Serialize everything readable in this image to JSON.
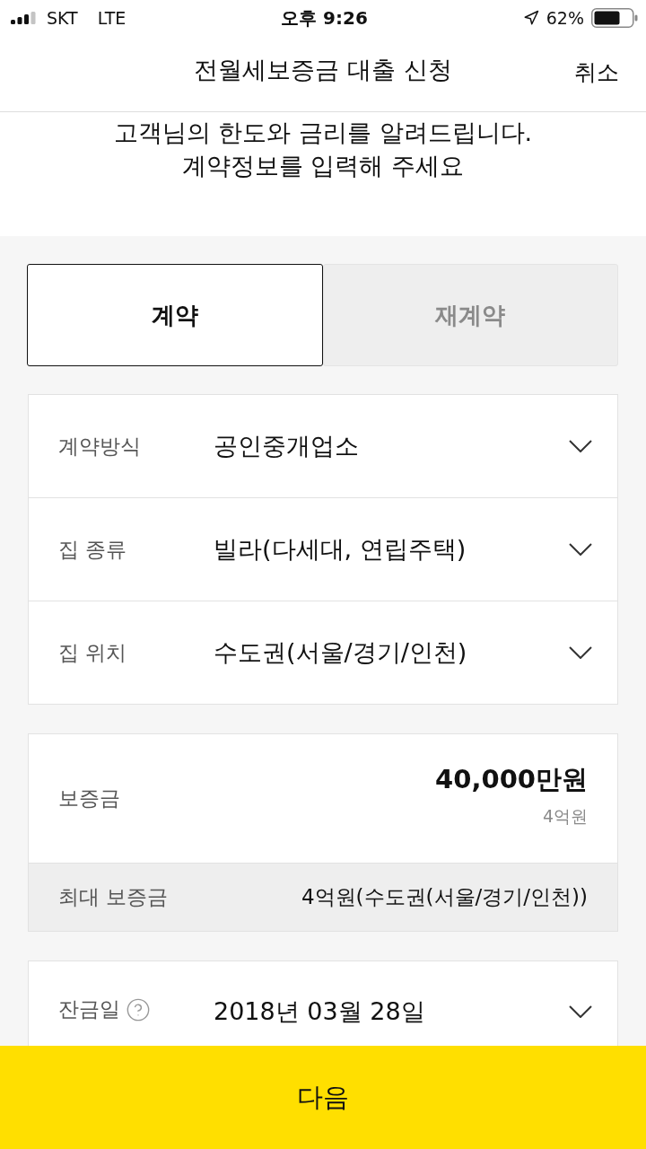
{
  "status_bar": {
    "carrier": "SKT",
    "network": "LTE",
    "time": "오후 9:26",
    "battery": "62%"
  },
  "header": {
    "title": "전월세보증금 대출 신청",
    "cancel": "취소"
  },
  "intro": [
    "고객님의 한도와 금리를 알려드립니다.",
    "계약정보를 입력해 주세요"
  ],
  "tabs": [
    {
      "label": "계약",
      "selected": true
    },
    {
      "label": "재계약",
      "selected": false
    }
  ],
  "contract_fields": [
    {
      "label": "계약방식",
      "value": "공인중개업소"
    },
    {
      "label": "집 종류",
      "value": "빌라(다세대, 연립주택)"
    },
    {
      "label": "집 위치",
      "value": "수도권(서울/경기/인천)"
    }
  ],
  "deposit": {
    "label": "보증금",
    "amount": "40,000만원",
    "amount_in_words": "4억원",
    "max_label": "최대 보증금",
    "max_value": "4억원(수도권(서울/경기/인천))"
  },
  "balance_date": {
    "label": "잔금일",
    "value": "2018년 03월 28일"
  },
  "next_button": "다음"
}
